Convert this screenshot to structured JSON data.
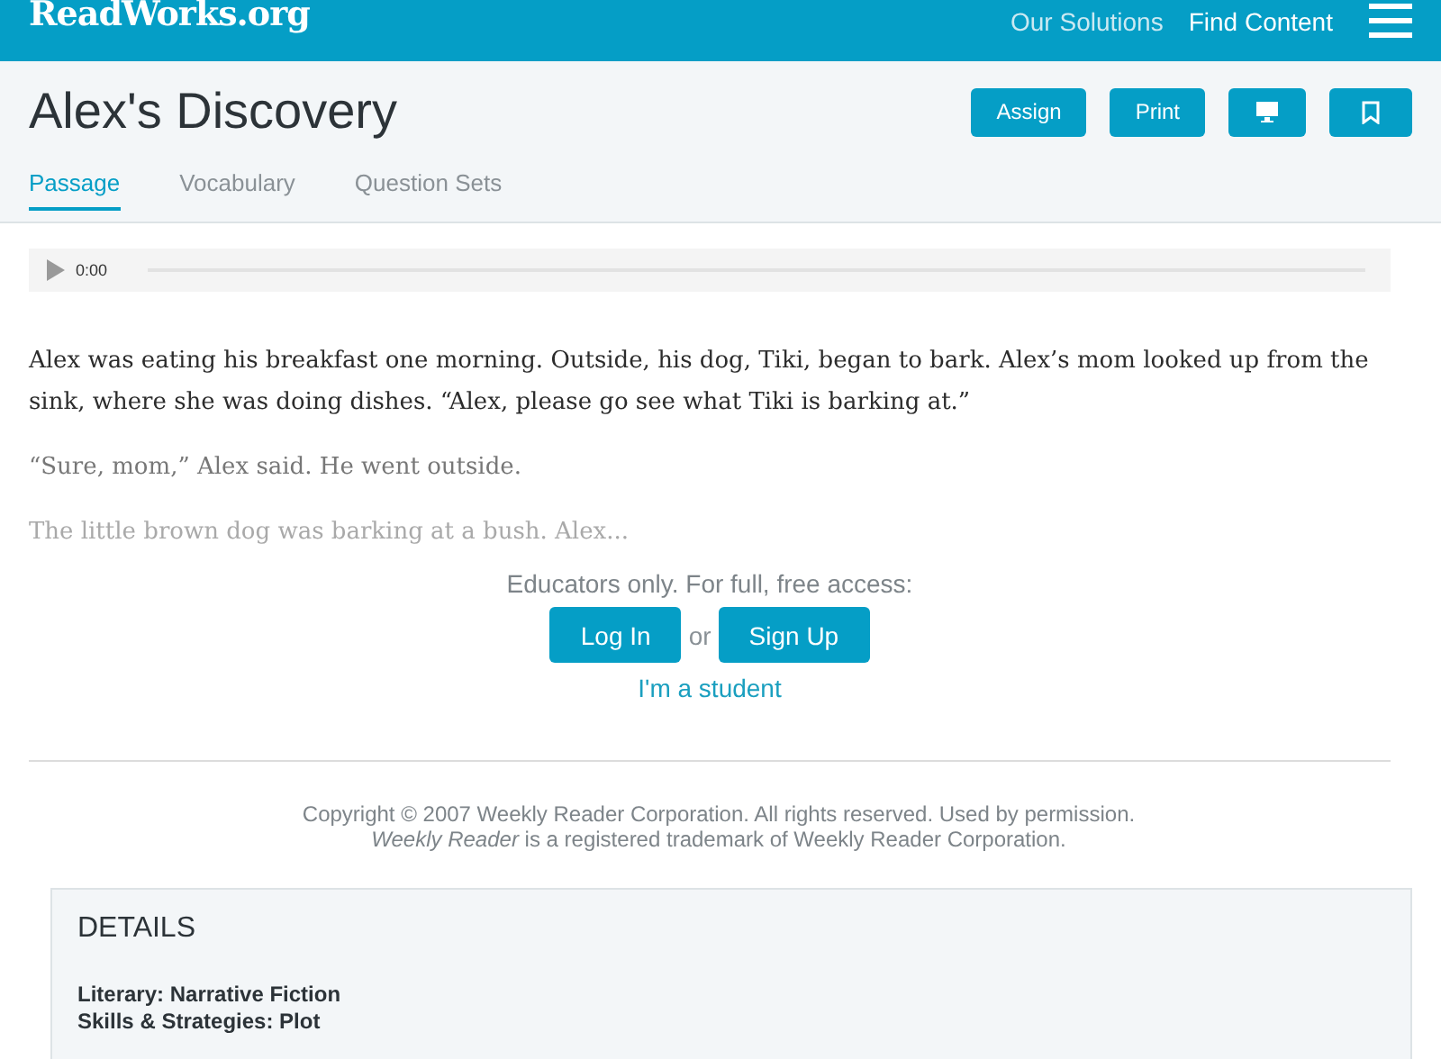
{
  "header": {
    "logo": "ReadWorks.org",
    "nav": [
      "Our Solutions",
      "Find Content"
    ]
  },
  "title": "Alex's Discovery",
  "actions": [
    {
      "kind": "text",
      "label": "Assign"
    },
    {
      "kind": "text",
      "label": "Print"
    },
    {
      "kind": "monitor"
    },
    {
      "kind": "bookmark"
    }
  ],
  "tabs": [
    {
      "label": "Passage",
      "selected": true
    },
    {
      "label": "Vocabulary",
      "selected": false
    },
    {
      "label": "Question Sets",
      "selected": false
    }
  ],
  "audio": {
    "time": "0:00"
  },
  "paragraphs": [
    {
      "kind": "full",
      "text": "Alex was eating his breakfast one morning. Outside, his dog, Tiki, began to bark. Alex’s mom looked up from the sink, where she was doing dishes. “Alex, please go see what Tiki is barking at.”"
    },
    {
      "kind": "dim",
      "text": "“Sure, mom,” Alex said. He went outside."
    },
    {
      "kind": "faint",
      "text": "The little brown dog was barking at a bush. Alex..."
    }
  ],
  "access": {
    "prompt": "Educators only. For full, free access:",
    "login": "Log In",
    "or": "or",
    "signup": "Sign Up",
    "student": "I'm a student"
  },
  "copyright": [
    "Copyright © 2007 Weekly Reader Corporation. All rights reserved. Used by permission.",
    "*Weekly Reader* is a registered trademark of Weekly Reader Corporation."
  ],
  "details": {
    "heading": "DETAILS",
    "items": [
      "Literary: Narrative Fiction",
      "Skills & Strategies: Plot"
    ]
  }
}
